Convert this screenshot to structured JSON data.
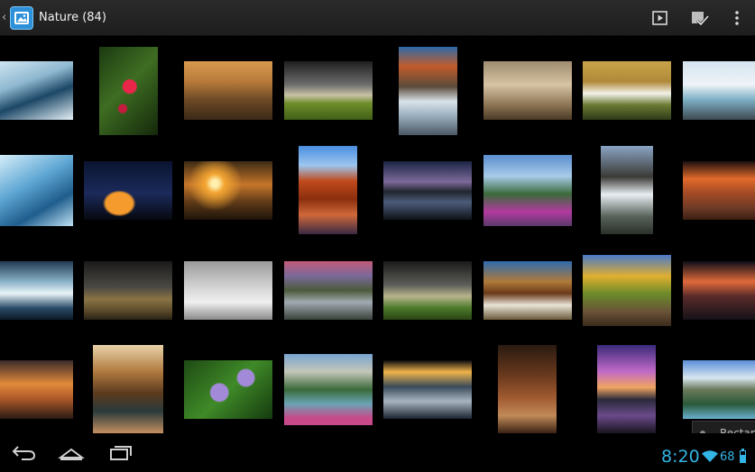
{
  "actionbar": {
    "title": "Nature (84)",
    "icons": {
      "back": "chevron-left-icon",
      "app": "gallery-app-icon",
      "slideshow": "slideshow-play-icon",
      "select": "select-checkmark-icon",
      "more": "overflow-menu-icon"
    }
  },
  "album": {
    "name": "Nature",
    "count": 84
  },
  "popup": {
    "label": "Rectan"
  },
  "statusbar": {
    "time": "8:20",
    "battery_percent": "68",
    "battery_level": 0.68,
    "accent_color": "#33b5e5"
  },
  "navbar": {
    "icons": [
      "back-arrow-icon",
      "home-icon",
      "recent-apps-icon"
    ]
  },
  "colors": {
    "background": "#000000",
    "actionbar": "#262626",
    "accent": "#33b5e5"
  }
}
